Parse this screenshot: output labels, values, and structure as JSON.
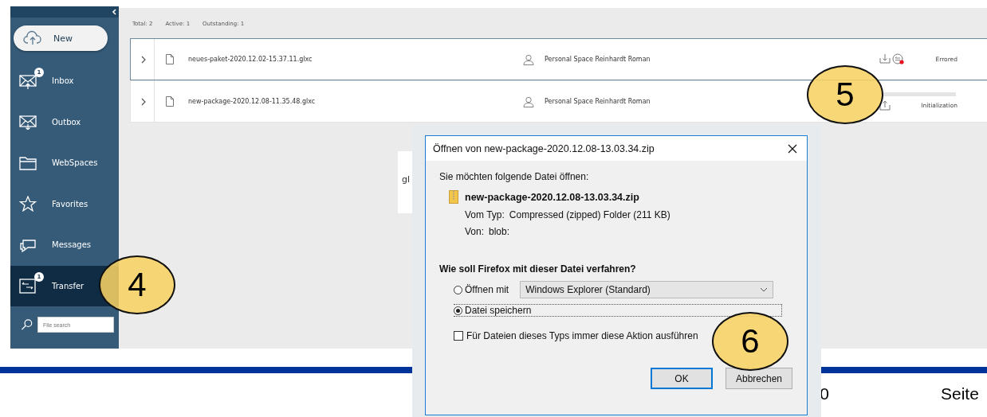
{
  "sidebar": {
    "new_button": "New",
    "items": [
      {
        "kind": "inbox",
        "label": "Inbox",
        "badge": "1",
        "selected": false
      },
      {
        "kind": "outbox",
        "label": "Outbox",
        "selected": false
      },
      {
        "kind": "folder",
        "label": "WebSpaces",
        "selected": false
      },
      {
        "kind": "star",
        "label": "Favorites",
        "selected": false
      },
      {
        "kind": "chat",
        "label": "Messages",
        "selected": false
      },
      {
        "kind": "transfer",
        "label": "Transfer",
        "badge": "1",
        "selected": true
      }
    ],
    "search": {
      "placeholder": "File search"
    }
  },
  "summary": [
    "Total: 2",
    "Active: 1",
    "Outstanding: 1"
  ],
  "transfers": [
    {
      "name": "neues-paket-2020.12.02-15.37.11.glxc",
      "owner": "Personal Space Reinhardt Roman",
      "kind": "download",
      "error": true,
      "status": "Errored",
      "selected": true
    },
    {
      "name": "new-package-2020.12.08-11.35.48.glxc",
      "owner": "Personal Space Reinhardt Roman",
      "kind": "upload",
      "error": false,
      "level": 0,
      "status": "Initialization",
      "selected": false
    }
  ],
  "background_panel": {
    "text": "gl"
  },
  "dialog": {
    "title": "Öffnen von new-package-2020.12.08-13.03.34.zip",
    "intro": "Sie möchten folgende Datei öffnen:",
    "file_name": "new-package-2020.12.08-13.03.34.zip",
    "type_label": "Vom Typ:",
    "type_value": "Compressed (zipped) Folder (211 KB)",
    "from_label": "Von:",
    "from_value": "blob:",
    "question": "Wie soll Firefox mit dieser Datei verfahren?",
    "options": [
      {
        "label": "Öffnen mit",
        "selected": false
      },
      {
        "label": "Datei speichern",
        "selected": true
      }
    ],
    "open_with": "Windows Explorer (Standard)",
    "remember": {
      "label": "Für Dateien dieses Typs immer diese Aktion ausführen",
      "checked": false
    },
    "buttons": [
      {
        "label": "OK",
        "default": true
      },
      {
        "label": "Abbrechen",
        "default": false
      }
    ]
  },
  "callouts": [
    "4",
    "5",
    "6"
  ],
  "footer": {
    "number": "0",
    "page": "Seite"
  }
}
